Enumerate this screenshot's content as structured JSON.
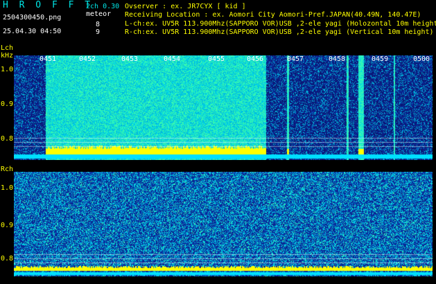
{
  "header": {
    "app_logo": "H R O F F T",
    "file_name": "2504300450.png",
    "datetime": "25.04.30 04:50",
    "version": "2ch 0.30",
    "mode": "meteor",
    "meteor_count_l": "8",
    "meteor_count_r": "9"
  },
  "info": {
    "observer": "Ovserver            : ex. JR7CYX [ kid ]",
    "location": "Receiving Location : ex. Aomori City Aomori-Pref.JAPAN(40.49N, 140.47E)",
    "lch": "L-ch:ex. UV5R 113.900Mhz(SAPPORO VOR)USB ,2-ele yagi (Holozontal 10m height",
    "rch": "R-ch:ex. UV5R 113.900Mhz(SAPPORO VOR)USB ,2-ele yagi (Vertical 10m height)"
  },
  "lch": {
    "label": "Lch",
    "unit": "kHz",
    "y_ticks": [
      "1.0",
      "0.9",
      "0.8"
    ],
    "time_labels": [
      "0451",
      "0452",
      "0453",
      "0454",
      "0455",
      "0456",
      "0457",
      "0458",
      "0459",
      "0500"
    ]
  },
  "rch": {
    "label": "Rch",
    "y_ticks": [
      "1.0",
      "0.9",
      "0.8"
    ]
  },
  "colors": {
    "background": "#000000",
    "spectrum_low": "#0a1a7a",
    "spectrum_high": "#00e0ff",
    "baseline": "#ffff00",
    "text_yellow": "#ffff00",
    "text_cyan": "#00e5e5"
  }
}
